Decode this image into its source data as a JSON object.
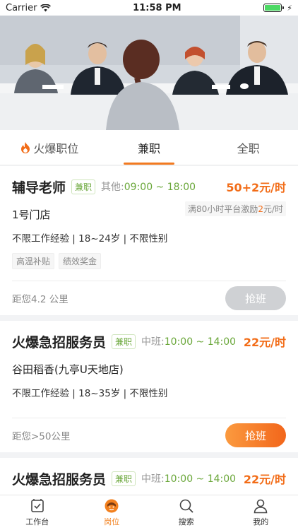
{
  "status_bar": {
    "carrier": "Carrier",
    "time": "11:58 PM"
  },
  "tabs": [
    {
      "label": "火爆职位",
      "icon": "flame-icon",
      "active": false
    },
    {
      "label": "兼职",
      "active": true
    },
    {
      "label": "全职",
      "active": false
    }
  ],
  "jobs": [
    {
      "title": "辅导老师",
      "type": "兼职",
      "shift_label": "其他:",
      "shift_time": "09:00 ~ 18:00",
      "pay": "50+2元/时",
      "bonus_prefix": "满80小时平台激励",
      "bonus_amount": "2",
      "bonus_suffix": "元/时",
      "store": "1号门店",
      "requirements": "不限工作经验 | 18~24岁 | 不限性别",
      "tags": [
        "高温补贴",
        "绩效奖金"
      ],
      "distance": "距您4.2 公里",
      "button": "抢班"
    },
    {
      "title": "火爆急招服务员",
      "type": "兼职",
      "shift_label": "中班:",
      "shift_time": "10:00 ~ 14:00",
      "pay": "22元/时",
      "store": "谷田稻香(九亭U天地店)",
      "requirements": "不限工作经验 | 18~35岁 | 不限性别",
      "distance": "距您>50公里",
      "button": "抢班"
    },
    {
      "title": "火爆急招服务员",
      "type": "兼职",
      "shift_label": "中班:",
      "shift_time": "10:00 ~ 14:00",
      "pay": "22元/时"
    }
  ],
  "tab_bar": [
    {
      "label": "工作台",
      "icon": "workbench-icon"
    },
    {
      "label": "岗位",
      "icon": "position-icon",
      "active": true
    },
    {
      "label": "搜索",
      "icon": "search-icon"
    },
    {
      "label": "我的",
      "icon": "profile-icon"
    }
  ],
  "colors": {
    "accent": "#f27a21",
    "pay": "#f26c17",
    "shift_time": "#6aa73a"
  }
}
